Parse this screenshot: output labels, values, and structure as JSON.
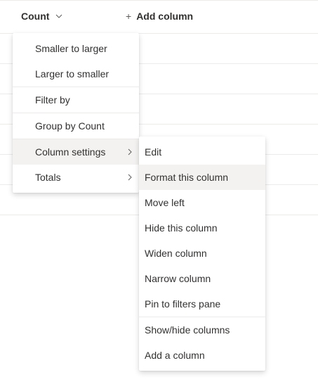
{
  "header": {
    "count_label": "Count",
    "add_column_label": "Add column",
    "plus_glyph": "+"
  },
  "main_menu": {
    "items": [
      {
        "label": "Smaller to larger"
      },
      {
        "label": "Larger to smaller"
      },
      {
        "label": "Filter by"
      },
      {
        "label": "Group by Count"
      },
      {
        "label": "Column settings"
      },
      {
        "label": "Totals"
      }
    ]
  },
  "sub_menu": {
    "items": [
      {
        "label": "Edit"
      },
      {
        "label": "Format this column"
      },
      {
        "label": "Move left"
      },
      {
        "label": "Hide this column"
      },
      {
        "label": "Widen column"
      },
      {
        "label": "Narrow column"
      },
      {
        "label": "Pin to filters pane"
      },
      {
        "label": "Show/hide columns"
      },
      {
        "label": "Add a column"
      }
    ]
  },
  "colors": {
    "text": "#323130",
    "hover": "#f3f2f1",
    "divider": "#edebe9"
  }
}
